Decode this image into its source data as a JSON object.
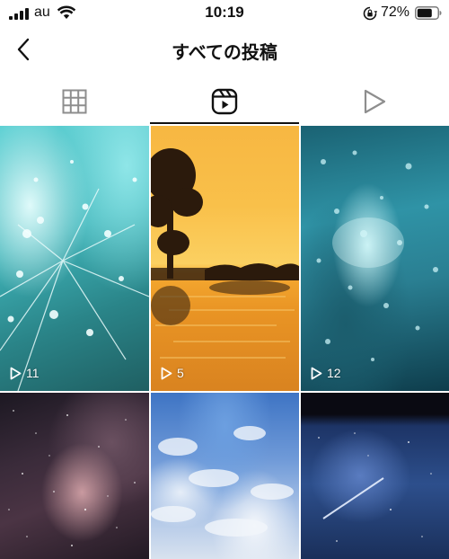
{
  "status_bar": {
    "carrier": "au",
    "time": "10:19",
    "battery_percent": "72%",
    "icons": [
      "signal-icon",
      "wifi-icon",
      "rotation-lock-icon",
      "battery-icon"
    ]
  },
  "header": {
    "title": "すべての投稿",
    "back_icon": "chevron-left-icon"
  },
  "tabs": [
    {
      "icon": "grid-icon",
      "active": false
    },
    {
      "icon": "reels-icon",
      "active": true
    },
    {
      "icon": "play-icon",
      "active": false
    }
  ],
  "grid": {
    "tiles": [
      {
        "image": "dandelion-water-drops",
        "play_count": "11"
      },
      {
        "image": "sunset-lake-tree",
        "play_count": "5"
      },
      {
        "image": "underwater-bubbles",
        "play_count": "12"
      },
      {
        "image": "milky-way-night-sky",
        "play_count": ""
      },
      {
        "image": "blue-sky-clouds",
        "play_count": ""
      },
      {
        "image": "meteor-night-sky",
        "play_count": ""
      }
    ]
  },
  "colors": {
    "text": "#111111",
    "tab_inactive": "#8e8e8e",
    "background": "#ffffff"
  }
}
